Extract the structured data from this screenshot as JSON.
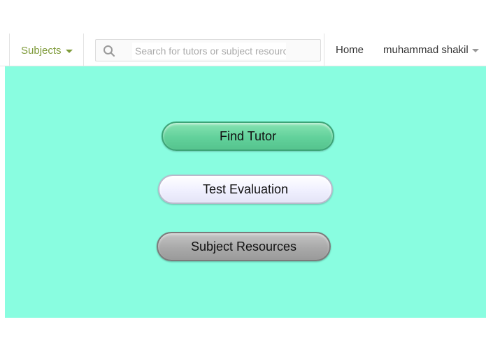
{
  "navbar": {
    "subjects_label": "Subjects",
    "search": {
      "placeholder": "Search for tutors or subject resources",
      "value": ""
    },
    "home_label": "Home",
    "user_name": "muhammad shakil"
  },
  "main": {
    "background": "#89fde0",
    "buttons": [
      {
        "label": "Find Tutor",
        "color": "#62d19b"
      },
      {
        "label": "Test Evaluation",
        "color": "#f1f1ff"
      },
      {
        "label": "Subject Resources",
        "color": "#a9a9a9"
      }
    ]
  },
  "colors": {
    "subjects_accent": "#7f9b3a",
    "nav_text": "#333333"
  },
  "icons": {
    "search": "search-icon",
    "subjects_dropdown": "chevron-down-icon",
    "user_dropdown": "chevron-down-icon"
  }
}
